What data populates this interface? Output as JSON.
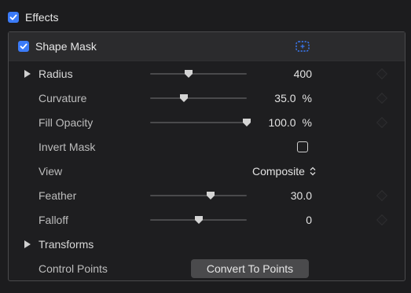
{
  "effects": {
    "title": "Effects",
    "checked": true
  },
  "shape_mask": {
    "title": "Shape Mask",
    "checked": true,
    "onscreen_icon": "onscreen-controls-icon"
  },
  "params": {
    "radius": {
      "label": "Radius",
      "value": "400",
      "unit": "",
      "slider_fraction": 0.4
    },
    "curvature": {
      "label": "Curvature",
      "value": "35.0",
      "unit": "%",
      "slider_fraction": 0.35
    },
    "fill_opacity": {
      "label": "Fill Opacity",
      "value": "100.0",
      "unit": "%",
      "slider_fraction": 1.0
    },
    "invert_mask": {
      "label": "Invert Mask",
      "checked": false
    },
    "view": {
      "label": "View",
      "value": "Composite",
      "icon": "chevron-updown-icon"
    },
    "feather": {
      "label": "Feather",
      "value": "30.0",
      "unit": "",
      "slider_fraction": 0.63
    },
    "falloff": {
      "label": "Falloff",
      "value": "0",
      "unit": "",
      "slider_fraction": 0.5
    },
    "transforms": {
      "label": "Transforms"
    },
    "control_points": {
      "label": "Control Points",
      "button": "Convert To Points"
    }
  },
  "colors": {
    "accent": "#3b7bf7",
    "background": "#1c1c1e",
    "header": "#2b2b2d"
  }
}
